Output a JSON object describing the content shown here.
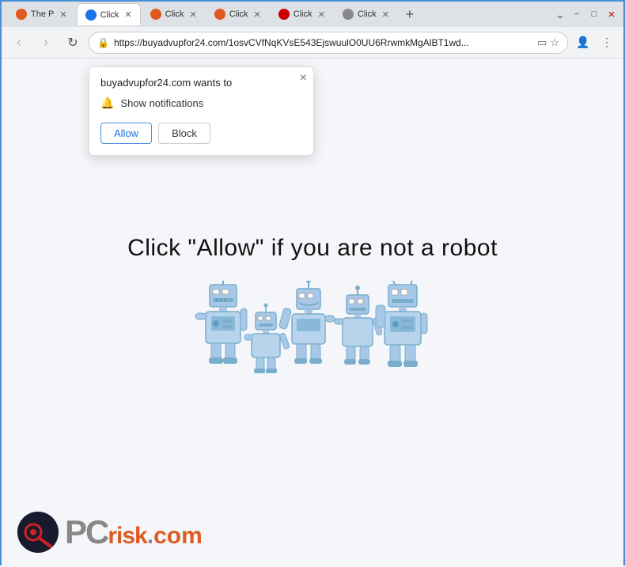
{
  "titlebar": {
    "tabs": [
      {
        "label": "The P",
        "icon_color": "#e05a20",
        "active": false,
        "id": "tab-1"
      },
      {
        "label": "Click",
        "icon_color": "#1a73e8",
        "active": true,
        "id": "tab-2"
      },
      {
        "label": "Click",
        "icon_color": "#e05a20",
        "active": false,
        "id": "tab-3"
      },
      {
        "label": "Click",
        "icon_color": "#e05a20",
        "active": false,
        "id": "tab-4"
      },
      {
        "label": "Click",
        "icon_color": "#cc0000",
        "active": false,
        "id": "tab-5"
      },
      {
        "label": "Click",
        "icon_color": "#888",
        "active": false,
        "id": "tab-6"
      }
    ],
    "new_tab_label": "+",
    "minimize_label": "−",
    "maximize_label": "□",
    "close_label": "✕",
    "chevron_down": "⌄"
  },
  "navbar": {
    "back_title": "Back",
    "forward_title": "Forward",
    "reload_title": "Reload",
    "url": "https://buyadvupfor24.com/1osvCVfNqKVsE543EjswuulO0UU6RrwmkMgAlBT1wd...",
    "url_short": "https://buyadvupfor24.com/1osvCVfNqKVsE543EjswuulO0UU6RrwmkMgAlBT1wd...",
    "bookmark_icon": "☆",
    "cast_icon": "▭",
    "profile_icon": "◯",
    "menu_icon": "⋮"
  },
  "popup": {
    "title": "buyadvupfor24.com wants to",
    "close_label": "×",
    "permission_label": "Show notifications",
    "allow_label": "Allow",
    "block_label": "Block"
  },
  "main_content": {
    "heading": "Click \"Allow\"   if you are not   a robot"
  },
  "pcrisk": {
    "pc_text": "PC",
    "risk_text": "risk",
    "dot_text": ".",
    "com_text": "com"
  }
}
